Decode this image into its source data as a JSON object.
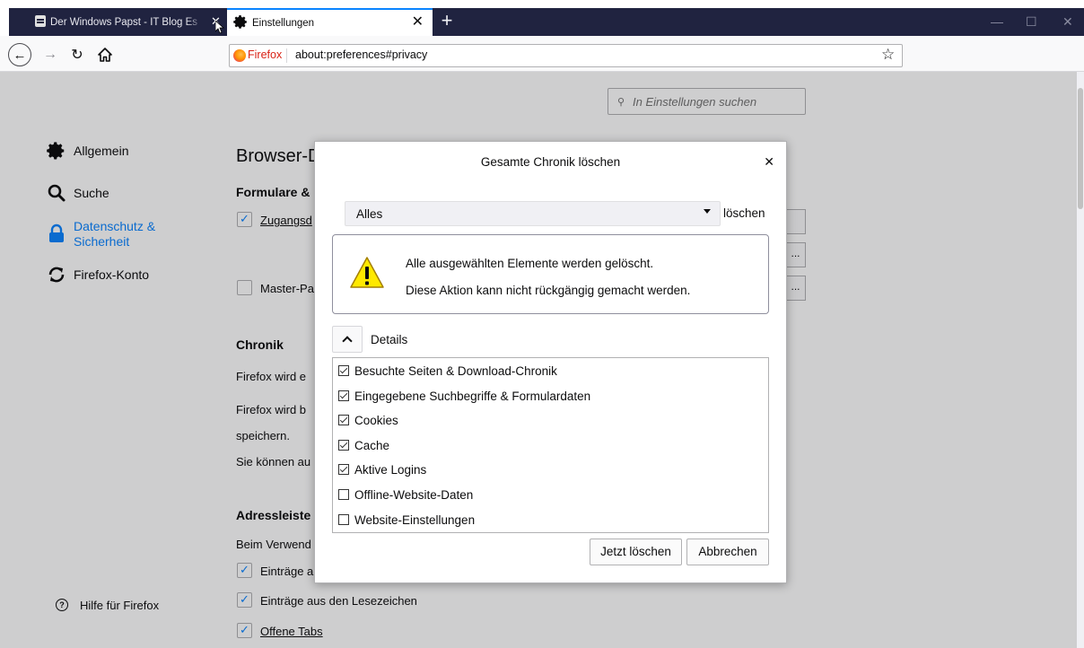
{
  "tabs": [
    {
      "title": "Der Windows Papst - IT Blog Es"
    },
    {
      "title": "Einstellungen"
    }
  ],
  "navbar": {
    "identity": "Firefox",
    "url": "about:preferences#privacy"
  },
  "search": {
    "placeholder": "In Einstellungen suchen"
  },
  "sidebar": {
    "items": [
      {
        "label": "Allgemein",
        "icon": "gear-icon"
      },
      {
        "label": "Suche",
        "icon": "search-icon"
      },
      {
        "label": "Datenschutz & Sicherheit",
        "line1": "Datenschutz &",
        "line2": "Sicherheit",
        "icon": "lock-icon",
        "selected": true
      },
      {
        "label": "Firefox-Konto",
        "icon": "sync-icon"
      }
    ],
    "help": "Hilfe für Firefox"
  },
  "main": {
    "heading": "Browser-D",
    "forms_heading": "Formulare &",
    "logins_cb": "Zugangsd",
    "master_cb": "Master-Pa",
    "history_heading": "Chronik",
    "history_line1": "Firefox wird e",
    "history_line2": "Firefox wird b",
    "history_line3": "speichern.",
    "history_line4": "Sie können au",
    "addressbar_heading": "Adressleiste",
    "addressbar_line": "Beim Verwend",
    "addr_cb1": "Einträge a",
    "addr_cb2": "Einträge aus den Lesezeichen",
    "addr_cb3": "Offene Tabs",
    "ghost_dots": "..."
  },
  "dialog": {
    "title": "Gesamte Chronik löschen",
    "range_value": "Alles",
    "range_suffix": "löschen",
    "warning_line1": "Alle ausgewählten Elemente werden gelöscht.",
    "warning_line2": "Diese Aktion kann nicht rückgängig gemacht werden.",
    "details_label": "Details",
    "items": [
      {
        "label": "Besuchte Seiten & Download-Chronik",
        "checked": true
      },
      {
        "label": "Eingegebene Suchbegriffe & Formulardaten",
        "checked": true
      },
      {
        "label": "Cookies",
        "checked": true
      },
      {
        "label": "Cache",
        "checked": true
      },
      {
        "label": "Aktive Logins",
        "checked": true
      },
      {
        "label": "Offline-Website-Daten",
        "checked": false
      },
      {
        "label": "Website-Einstellungen",
        "checked": false
      }
    ],
    "ok_button": "Jetzt löschen",
    "cancel_button": "Abbrechen"
  },
  "colors": {
    "accent": "#0a84ff",
    "tabbar": "#202340",
    "warning": "#ffe900"
  }
}
